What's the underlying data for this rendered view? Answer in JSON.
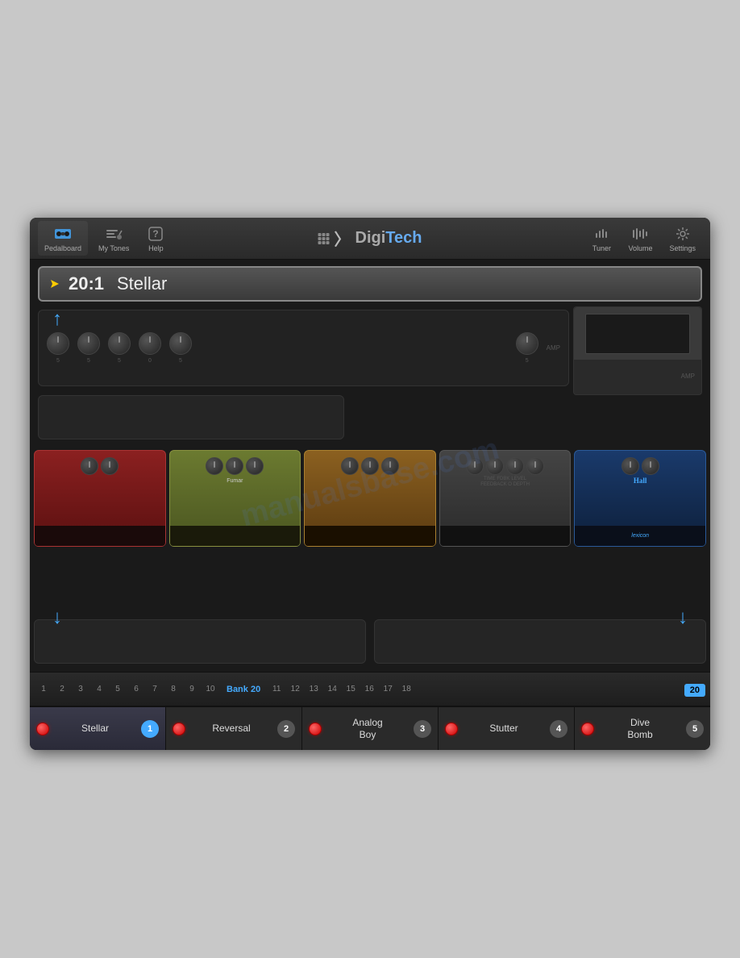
{
  "app": {
    "title": "DigiTech",
    "background_color": "#c8c8c8"
  },
  "toolbar": {
    "pedalboard_label": "Pedalboard",
    "my_tones_label": "My Tones",
    "help_label": "Help",
    "tuner_label": "Tuner",
    "volume_label": "Volume",
    "settings_label": "Settings",
    "logo_text": "DigiTech"
  },
  "preset": {
    "number": "20:1",
    "name": "Stellar"
  },
  "bank": {
    "label": "Bank 20",
    "badge": "20",
    "numbers_left": [
      "1",
      "2",
      "3",
      "4",
      "5",
      "6",
      "7",
      "8",
      "9",
      "10"
    ],
    "numbers_right": [
      "11",
      "12",
      "13",
      "14",
      "15",
      "16",
      "17",
      "18"
    ]
  },
  "footer_presets": [
    {
      "label": "Stellar",
      "number": "1",
      "active": true
    },
    {
      "label": "Reversal",
      "number": "2",
      "active": false
    },
    {
      "label": "Analog Boy",
      "number": "3",
      "active": false
    },
    {
      "label": "Stutter",
      "number": "4",
      "active": false
    },
    {
      "label": "Dive Bomb",
      "number": "5",
      "active": false
    }
  ],
  "watermark": "manualsbase.com"
}
